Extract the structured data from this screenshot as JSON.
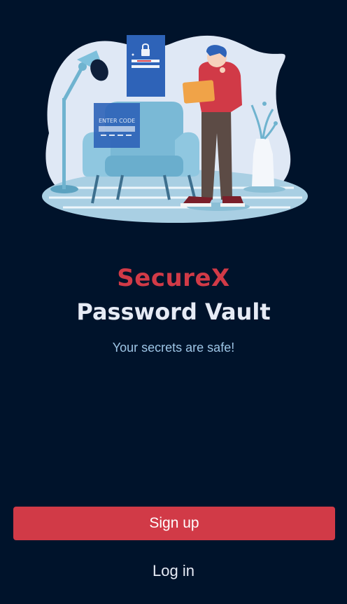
{
  "brand": {
    "name": "SecureX",
    "accent_color": "#d13a47"
  },
  "app": {
    "title": "Password Vault",
    "tagline": "Your secrets are safe!"
  },
  "hero": {
    "panel_text": "ENTER CODE"
  },
  "actions": {
    "signup_label": "Sign up",
    "login_label": "Log in"
  },
  "colors": {
    "background": "#00132b",
    "primary_button": "#d13a47",
    "text_light": "#e6ebf5",
    "tagline": "#9ec6e6"
  }
}
